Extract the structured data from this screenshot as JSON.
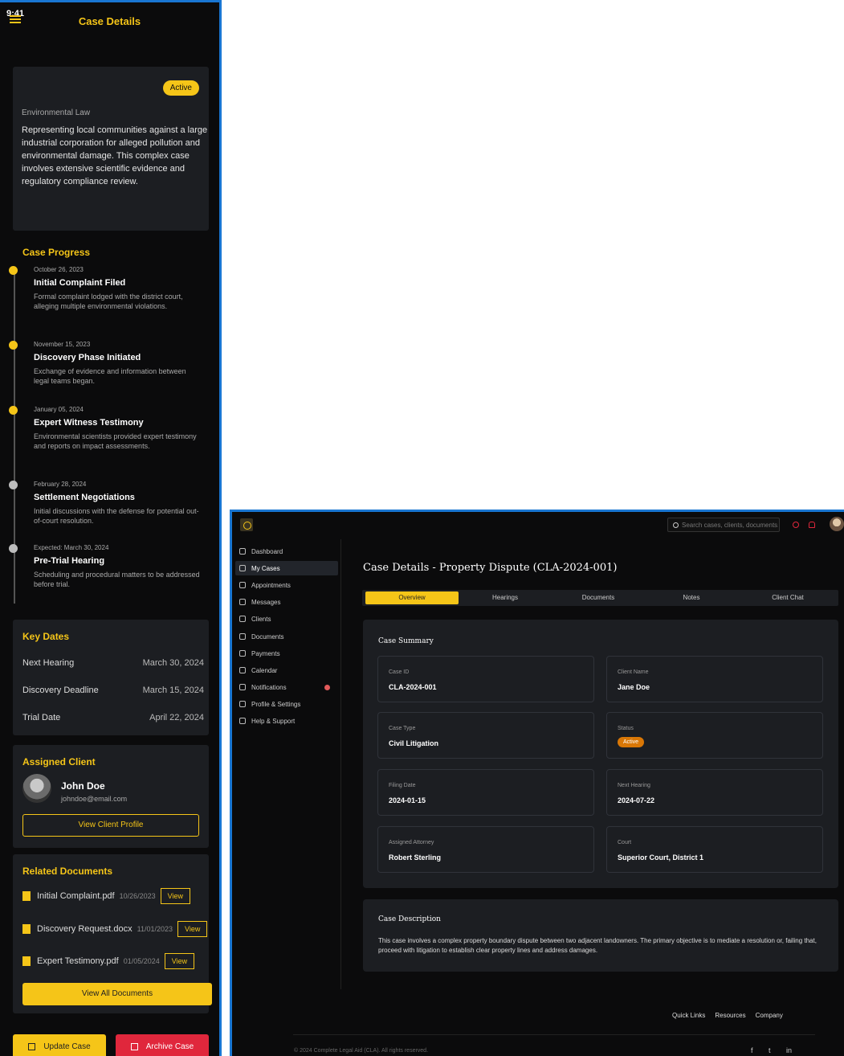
{
  "mobile": {
    "status_time": "9:41",
    "header_title": "Case Details",
    "summary": {
      "status": "Active",
      "law_type": "Environmental Law",
      "description": "Representing local communities against a large industrial corporation for alleged pollution and environmental damage. This complex case involves extensive scientific evidence and regulatory compliance review."
    },
    "progress_title": "Case Progress",
    "timeline": [
      {
        "date": "October 26, 2023",
        "title": "Initial Complaint Filed",
        "text": "Formal complaint lodged with the district court, alleging multiple environmental violations.",
        "done": true
      },
      {
        "date": "November 15, 2023",
        "title": "Discovery Phase Initiated",
        "text": "Exchange of evidence and information between legal teams began.",
        "done": true
      },
      {
        "date": "January 05, 2024",
        "title": "Expert Witness Testimony",
        "text": "Environmental scientists provided expert testimony and reports on impact assessments.",
        "done": true
      },
      {
        "date": "February 28, 2024",
        "title": "Settlement Negotiations",
        "text": "Initial discussions with the defense for potential out-of-court resolution.",
        "done": false
      },
      {
        "date": "Expected: March 30, 2024",
        "title": "Pre-Trial Hearing",
        "text": "Scheduling and procedural matters to be addressed before trial.",
        "done": false
      }
    ],
    "key_dates": {
      "title": "Key Dates",
      "rows": [
        {
          "label": "Next Hearing",
          "value": "March 30, 2024"
        },
        {
          "label": "Discovery Deadline",
          "value": "March 15, 2024"
        },
        {
          "label": "Trial Date",
          "value": "April 22, 2024"
        }
      ]
    },
    "client": {
      "title": "Assigned Client",
      "name": "John Doe",
      "email": "johndoe@email.com",
      "button": "View Client Profile"
    },
    "documents": {
      "title": "Related Documents",
      "items": [
        {
          "name": "Initial Complaint.pdf",
          "date": "10/26/2023",
          "action": "View"
        },
        {
          "name": "Discovery Request.docx",
          "date": "11/01/2023",
          "action": "View"
        },
        {
          "name": "Expert Testimony.pdf",
          "date": "01/05/2024",
          "action": "View"
        }
      ],
      "view_all": "View All Documents"
    },
    "update_button": "Update Case",
    "archive_button": "Archive Case"
  },
  "desktop": {
    "search_placeholder": "Search cases, clients, documents...",
    "sidebar": [
      {
        "label": "Dashboard",
        "icon": "gauge-icon"
      },
      {
        "label": "My Cases",
        "icon": "briefcase-icon"
      },
      {
        "label": "Appointments",
        "icon": "calendar-check-icon"
      },
      {
        "label": "Messages",
        "icon": "message-icon"
      },
      {
        "label": "Clients",
        "icon": "users-icon"
      },
      {
        "label": "Documents",
        "icon": "folder-icon"
      },
      {
        "label": "Payments",
        "icon": "card-icon"
      },
      {
        "label": "Calendar",
        "icon": "calendar-icon"
      },
      {
        "label": "Notifications",
        "icon": "bell-icon"
      },
      {
        "label": "Profile & Settings",
        "icon": "gear-icon"
      },
      {
        "label": "Help & Support",
        "icon": "lifebuoy-icon"
      }
    ],
    "page_title": "Case Details - Property Dispute (CLA-2024-001)",
    "tabs": [
      "Overview",
      "Hearings",
      "Documents",
      "Notes",
      "Client Chat"
    ],
    "summary_title": "Case Summary",
    "fields": [
      {
        "label": "Case ID",
        "value": "CLA-2024-001"
      },
      {
        "label": "Client Name",
        "value": "Jane Doe"
      },
      {
        "label": "Case Type",
        "value": "Civil Litigation"
      },
      {
        "label": "Status",
        "value": "Active"
      },
      {
        "label": "Filing Date",
        "value": "2024-01-15"
      },
      {
        "label": "Next Hearing",
        "value": "2024-07-22"
      },
      {
        "label": "Assigned Attorney",
        "value": "Robert Sterling"
      },
      {
        "label": "Court",
        "value": "Superior Court, District 1"
      }
    ],
    "description_title": "Case Description",
    "description": "This case involves a complex property boundary dispute between two adjacent landowners. The primary objective is to mediate a resolution or, failing that, proceed with litigation to establish clear property lines and address damages.",
    "footer_links": [
      "Quick Links",
      "Resources",
      "Company"
    ],
    "copyright": "© 2024 Complete Legal Aid (CLA). All rights reserved.",
    "social": [
      "f",
      "t",
      "in"
    ]
  },
  "colors": {
    "accent": "#f5c518",
    "danger": "#e0273c",
    "status_orange": "#d97706",
    "background": "#0b0b0c",
    "card": "#1c1e22"
  }
}
